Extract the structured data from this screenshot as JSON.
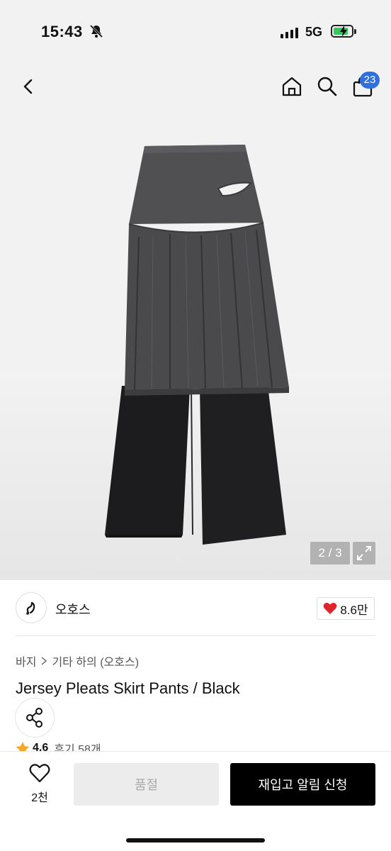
{
  "status_bar": {
    "time": "15:43",
    "network": "5G"
  },
  "nav": {
    "cart_count": "23"
  },
  "gallery": {
    "counter": "2 / 3"
  },
  "brand": {
    "name": "오호스",
    "likes": "8.6만"
  },
  "breadcrumb": {
    "category": "바지",
    "subcategory": "기타 하의 (오호스)"
  },
  "product": {
    "title": "Jersey Pleats Skirt Pants / Black",
    "rating": "4.6",
    "reviews": "후기 58개"
  },
  "bottom_bar": {
    "wish_count": "2천",
    "soldout_label": "품절",
    "notify_label": "재입고 알림 신청"
  },
  "colors": {
    "accent": "#2f6fde",
    "heart": "#e0242c",
    "star": "#f5a623"
  }
}
